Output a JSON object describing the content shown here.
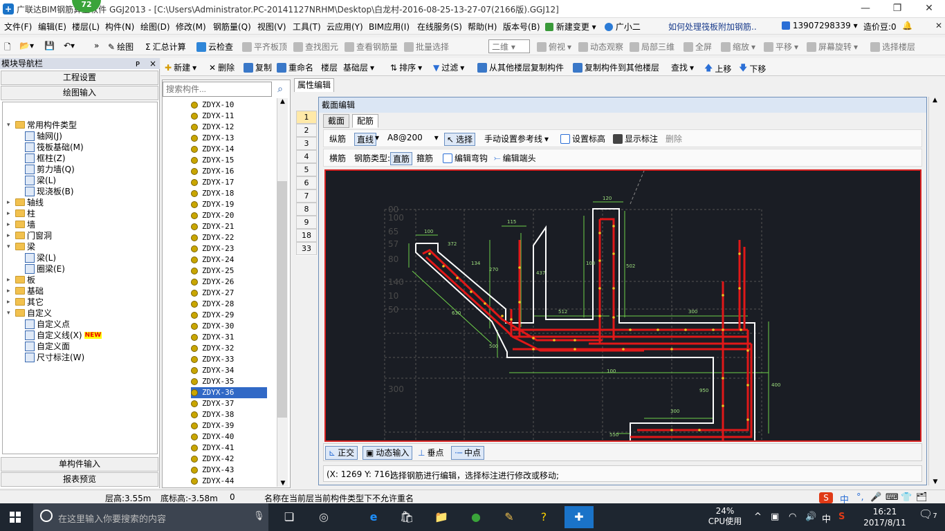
{
  "window": {
    "title": "广联达BIM钢筋算量软件 GGJ2013 - [C:\\Users\\Administrator.PC-20141127NRHM\\Desktop\\白龙村-2016-08-25-13-27-07(2166版).GGJ12]",
    "badge": "72",
    "min": "—",
    "restore": "❐",
    "close": "✕"
  },
  "menu": {
    "items": [
      "文件(F)",
      "编辑(E)",
      "楼层(L)",
      "构件(N)",
      "绘图(D)",
      "修改(M)",
      "钢筋量(Q)",
      "视图(V)",
      "工具(T)",
      "云应用(Y)",
      "BIM应用(I)",
      "在线服务(S)",
      "帮助(H)",
      "版本号(B)"
    ],
    "new_change": "新建变更",
    "guang": "广小二",
    "question": "如何处理筏板附加钢筋..",
    "phone": "13907298339",
    "price": "造价豆:0"
  },
  "toolbar1": {
    "draw": "绘图",
    "calc": "汇总计算",
    "cloud": "云检查",
    "align": "平齐板顶",
    "find": "查找图元",
    "view_rebar": "查看钢筋量",
    "batch": "批量选择",
    "mode": "二维",
    "top_view": "俯视",
    "dynamic": "动态观察",
    "local3d": "局部三维",
    "full": "全屏",
    "zoom": "缩放",
    "pan": "平移",
    "rotate": "屏幕旋转",
    "select_floor": "选择楼层"
  },
  "toolbar2": {
    "new": "新建",
    "delete": "删除",
    "copy": "复制",
    "rename": "重命名",
    "floor_label": "楼层",
    "floor": "基础层",
    "sort": "排序",
    "filter": "过滤",
    "copy_from": "从其他楼层复制构件",
    "copy_to": "复制构件到其他楼层",
    "find": "查找",
    "up": "上移",
    "down": "下移"
  },
  "nav": {
    "title": "模块导航栏",
    "pin": "ᴘ",
    "close": "×",
    "project": "工程设置",
    "drawing": "绘图输入",
    "single": "单构件输入",
    "report": "报表预览"
  },
  "tree": [
    {
      "label": "常用构件类型",
      "level": 0,
      "exp": "▾",
      "icon": "folder"
    },
    {
      "label": "轴网(J)",
      "level": 1,
      "icon": "comp"
    },
    {
      "label": "筏板基础(M)",
      "level": 1,
      "icon": "comp"
    },
    {
      "label": "框柱(Z)",
      "level": 1,
      "icon": "comp"
    },
    {
      "label": "剪力墙(Q)",
      "level": 1,
      "icon": "comp"
    },
    {
      "label": "梁(L)",
      "level": 1,
      "icon": "comp"
    },
    {
      "label": "现浇板(B)",
      "level": 1,
      "icon": "comp"
    },
    {
      "label": "轴线",
      "level": 0,
      "exp": "▸",
      "icon": "folder"
    },
    {
      "label": "柱",
      "level": 0,
      "exp": "▸",
      "icon": "folder"
    },
    {
      "label": "墙",
      "level": 0,
      "exp": "▸",
      "icon": "folder"
    },
    {
      "label": "门窗洞",
      "level": 0,
      "exp": "▸",
      "icon": "folder"
    },
    {
      "label": "梁",
      "level": 0,
      "exp": "▾",
      "icon": "folder"
    },
    {
      "label": "梁(L)",
      "level": 1,
      "icon": "comp"
    },
    {
      "label": "圈梁(E)",
      "level": 1,
      "icon": "comp"
    },
    {
      "label": "板",
      "level": 0,
      "exp": "▸",
      "icon": "folder"
    },
    {
      "label": "基础",
      "level": 0,
      "exp": "▸",
      "icon": "folder"
    },
    {
      "label": "其它",
      "level": 0,
      "exp": "▸",
      "icon": "folder"
    },
    {
      "label": "自定义",
      "level": 0,
      "exp": "▾",
      "icon": "folder"
    },
    {
      "label": "自定义点",
      "level": 1,
      "icon": "comp"
    },
    {
      "label": "自定义线(X)",
      "level": 1,
      "icon": "comp",
      "tag": "NEW"
    },
    {
      "label": "自定义面",
      "level": 1,
      "icon": "comp"
    },
    {
      "label": "尺寸标注(W)",
      "level": 1,
      "icon": "comp"
    }
  ],
  "search": {
    "placeholder": "搜索构件..."
  },
  "components": [
    "ZDYX-10",
    "ZDYX-11",
    "ZDYX-12",
    "ZDYX-13",
    "ZDYX-14",
    "ZDYX-15",
    "ZDYX-16",
    "ZDYX-17",
    "ZDYX-18",
    "ZDYX-19",
    "ZDYX-20",
    "ZDYX-21",
    "ZDYX-22",
    "ZDYX-23",
    "ZDYX-24",
    "ZDYX-25",
    "ZDYX-26",
    "ZDYX-27",
    "ZDYX-28",
    "ZDYX-29",
    "ZDYX-30",
    "ZDYX-31",
    "ZDYX-32",
    "ZDYX-33",
    "ZDYX-34",
    "ZDYX-35",
    "ZDYX-36",
    "ZDYX-37",
    "ZDYX-38",
    "ZDYX-39",
    "ZDYX-40",
    "ZDYX-41",
    "ZDYX-42",
    "ZDYX-43",
    "ZDYX-44"
  ],
  "selected_component": "ZDYX-36",
  "prop_tab": "属性编辑",
  "grid_rows": [
    "1",
    "2",
    "3",
    "4",
    "5",
    "6",
    "7",
    "8",
    "9",
    "18",
    "33"
  ],
  "dialog": {
    "title": "截面编辑",
    "tab_section": "截面",
    "tab_rebar": "配筋",
    "row1": {
      "longitudinal": "纵筋",
      "line": "直线",
      "spec": "A8@200",
      "select": "选择",
      "manual_ref": "手动设置参考线",
      "set_elev": "设置标高",
      "show_dim": "显示标注",
      "delete": "删除"
    },
    "row2": {
      "transverse": "横筋",
      "rebar_type": "钢筋类型:",
      "straight": "直筋",
      "stirrup": "箍筋",
      "edit_hook": "编辑弯钩",
      "edit_end": "编辑端头"
    },
    "bottom": {
      "ortho": "正交",
      "dynamic_input": "动态输入",
      "perp": "垂点",
      "mid": "中点"
    },
    "coord": "(X: 1269 Y: 716)",
    "hint": "选择钢筋进行编辑，选择标注进行修改或移动;"
  },
  "dims": [
    "120",
    "115",
    "100",
    "100",
    "134",
    "372",
    "270",
    "437",
    "502",
    "512",
    "300",
    "630",
    "500",
    "100",
    "950",
    "300",
    "400",
    "550",
    "100",
    "65",
    "57",
    "80",
    "140",
    "10",
    "50",
    "300",
    "00"
  ],
  "status": {
    "floor_h": "层高:3.55m",
    "bottom_h": "底标高:-3.58m",
    "zero": "0",
    "msg": "名称在当前层当前构件类型下不允许重名"
  },
  "ime": [
    "中",
    "°,",
    "🎤",
    "⌨",
    "👕",
    "🗂"
  ],
  "taskbar": {
    "search": "在这里输入你要搜索的内容",
    "cpu_pct": "24%",
    "cpu_label": "CPU使用",
    "lang": "中",
    "time": "16:21",
    "date": "2017/8/11",
    "notif": "7"
  },
  "colors": {
    "accent": "#3169c6",
    "canvas_bg": "#1a1d24",
    "rebar": "#e01818",
    "outline": "#ffffff",
    "dim": "#6fd14a"
  }
}
